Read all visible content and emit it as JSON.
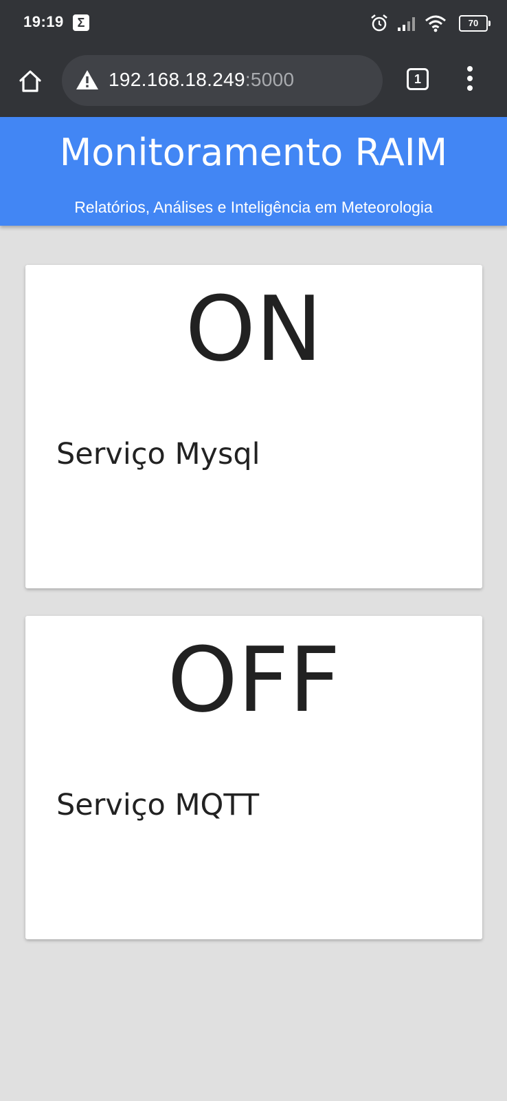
{
  "status_bar": {
    "time": "19:19",
    "notification_glyph": "Σ",
    "battery": "70",
    "icons": [
      "alarm-icon",
      "signal-icon",
      "wifi-icon",
      "battery-icon"
    ]
  },
  "browser": {
    "url_host": "192.168.18.249",
    "url_port": ":5000",
    "tab_count": "1",
    "icons": [
      "home-icon",
      "warning-icon",
      "tabs-icon",
      "more-menu-icon"
    ]
  },
  "header": {
    "title": "Monitoramento RAIM",
    "subtitle": "Relatórios, Análises e Inteligência em Meteorologia",
    "background_color": "#4286f4"
  },
  "services": [
    {
      "status": "ON",
      "label": "Serviço Mysql"
    },
    {
      "status": "OFF",
      "label": "Serviço MQTT"
    }
  ]
}
